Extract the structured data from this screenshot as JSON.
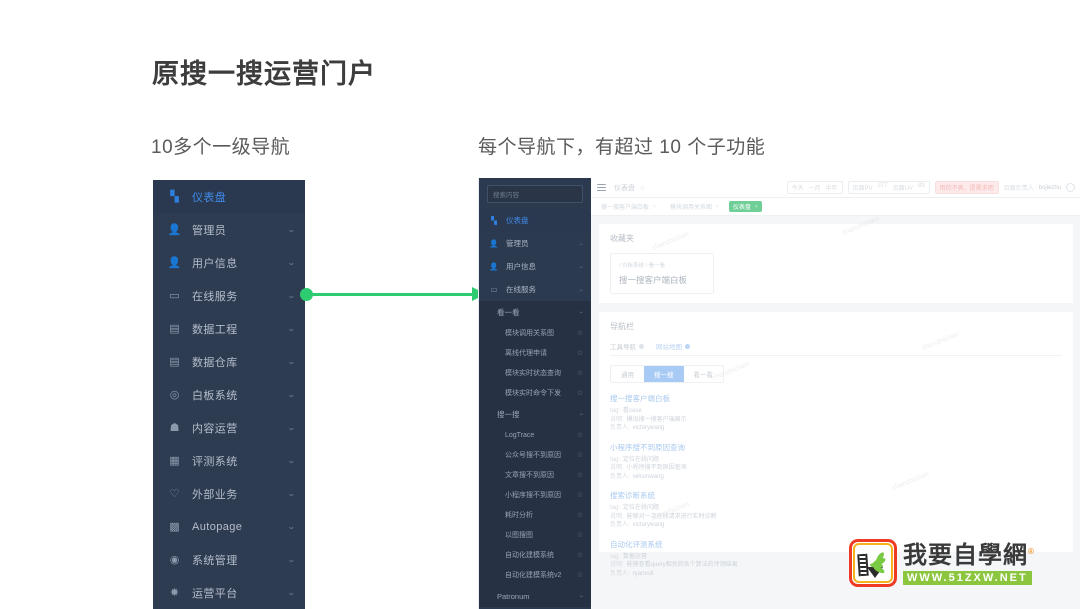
{
  "slide": {
    "title": "原搜一搜运营门户",
    "caption_left": "10多个一级导航",
    "caption_right": "每个导航下，有超过 10 个子功能"
  },
  "left_nav": {
    "items": [
      {
        "label": "仪表盘",
        "icon": "dashboard-icon",
        "glyph": "▚",
        "active": true,
        "chevron": ""
      },
      {
        "label": "管理员",
        "icon": "user-icon",
        "glyph": "👤",
        "active": false,
        "chevron": "⌄"
      },
      {
        "label": "用户信息",
        "icon": "user-info-icon",
        "glyph": "👤",
        "active": false,
        "chevron": "⌄"
      },
      {
        "label": "在线服务",
        "icon": "service-icon",
        "glyph": "▭",
        "active": false,
        "chevron": "⌄"
      },
      {
        "label": "数据工程",
        "icon": "data-engineering-icon",
        "glyph": "▤",
        "active": false,
        "chevron": "⌄"
      },
      {
        "label": "数据仓库",
        "icon": "data-warehouse-icon",
        "glyph": "▤",
        "active": false,
        "chevron": "⌄"
      },
      {
        "label": "白板系统",
        "icon": "whiteboard-icon",
        "glyph": "◎",
        "active": false,
        "chevron": "⌄"
      },
      {
        "label": "内容运营",
        "icon": "content-icon",
        "glyph": "☗",
        "active": false,
        "chevron": "⌄"
      },
      {
        "label": "评测系统",
        "icon": "evaluation-icon",
        "glyph": "▦",
        "active": false,
        "chevron": "⌄"
      },
      {
        "label": "外部业务",
        "icon": "external-business-icon",
        "glyph": "♡",
        "active": false,
        "chevron": "⌄"
      },
      {
        "label": "Autopage",
        "icon": "autopage-icon",
        "glyph": "▩",
        "active": false,
        "chevron": "⌄"
      },
      {
        "label": "系统管理",
        "icon": "system-management-icon",
        "glyph": "◉",
        "active": false,
        "chevron": "⌄"
      },
      {
        "label": "运营平台",
        "icon": "operation-platform-icon",
        "glyph": "✸",
        "active": false,
        "chevron": "⌄"
      }
    ]
  },
  "arrow": {
    "color": "#2ecc71",
    "name": "flow-arrow"
  },
  "app": {
    "sidebar": {
      "search_placeholder": "搜索内容",
      "items": [
        {
          "label": "仪表盘",
          "icon": "dashboard-icon",
          "glyph": "▚",
          "active": true,
          "chevron": ""
        },
        {
          "label": "管理员",
          "icon": "user-icon",
          "glyph": "👤",
          "active": false,
          "chevron": "⌄"
        },
        {
          "label": "用户信息",
          "icon": "user-info-icon",
          "glyph": "👤",
          "active": false,
          "chevron": "⌄"
        },
        {
          "label": "在线服务",
          "icon": "service-icon",
          "glyph": "▭",
          "active": false,
          "chevron": "⌄"
        }
      ],
      "groups": [
        {
          "label": "看一看",
          "chevron": "⌄",
          "children": [
            {
              "label": "模块调用关系图",
              "star": "☆"
            },
            {
              "label": "离线代理申请",
              "star": "☆"
            },
            {
              "label": "模块实时状态查询",
              "star": "☆"
            },
            {
              "label": "模块实时命令下发",
              "star": "☆"
            }
          ]
        },
        {
          "label": "搜一搜",
          "chevron": "⌄",
          "children": [
            {
              "label": "LogTrace",
              "star": "☆"
            },
            {
              "label": "公众号搜不到原因",
              "star": "☆"
            },
            {
              "label": "文章搜不到原因",
              "star": "☆"
            },
            {
              "label": "小程序搜不到原因",
              "star": "☆"
            },
            {
              "label": "耗时分析",
              "star": "☆"
            },
            {
              "label": "以图搜图",
              "star": "☆"
            },
            {
              "label": "自动化建模系统",
              "star": "☆"
            },
            {
              "label": "自动化建模系统v2",
              "star": "☆"
            }
          ]
        },
        {
          "label": "Patronum",
          "chevron": "⌄",
          "children": []
        }
      ]
    },
    "topbar": {
      "menu_icon": "hamburger-icon",
      "breadcrumb": "仪表盘",
      "star_icon": "☆",
      "ranges": [
        "今天",
        "一月",
        "半年"
      ],
      "pv_label": "页面PV",
      "pv_value": "377",
      "uv_label": "页面UV",
      "uv_value": "89",
      "alert_button": "用的不爽，提需求吧",
      "owner_label": "页面负责人",
      "owner_value": "bojiezhu"
    },
    "tabs": [
      {
        "label": "搜一搜客户端白板",
        "selected": false,
        "close": "×"
      },
      {
        "label": "模块调用关系图",
        "selected": false,
        "close": "×"
      },
      {
        "label": "仪表盘",
        "selected": true,
        "close": "×"
      }
    ],
    "favorites": {
      "title": "收藏夹",
      "card": {
        "breadcrumb": "/ 白板系统 / 看一看",
        "name": "搜一搜客户端白板"
      }
    },
    "navbar_card": {
      "title": "导航栏",
      "subtabs": [
        {
          "label": "工具导航",
          "on": false
        },
        {
          "label": "网站地图",
          "on": true
        }
      ],
      "segments": [
        {
          "label": "通用",
          "on": false
        },
        {
          "label": "搜一搜",
          "on": true
        },
        {
          "label": "看一看",
          "on": false
        }
      ],
      "entries": [
        {
          "title": "搜一搜客户端白板",
          "tag_label": "tag:",
          "tag_value": "看case",
          "desc_label": "说明:",
          "desc_value": "模拟搜一搜客户端展示",
          "owner_label": "负责人:",
          "owner_value": "victorywang"
        },
        {
          "title": "小程序搜不到原因查询",
          "tag_label": "tag:",
          "tag_value": "定位在线问题",
          "desc_label": "说明:",
          "desc_value": "小程序搜不到原因查询",
          "owner_label": "负责人:",
          "owner_value": "wilsonwang"
        },
        {
          "title": "搜索诊断系统",
          "tag_label": "tag:",
          "tag_value": "定位在线问题",
          "desc_label": "说明:",
          "desc_value": "能够对一次在线请求进行实时诊断",
          "owner_label": "负责人:",
          "owner_value": "victorywang"
        },
        {
          "title": "自动化评测系统",
          "tag_label": "tag:",
          "tag_value": "数据运营",
          "desc_label": "说明:",
          "desc_value": "能够查看query相关的各个算法的评测结果",
          "owner_label": "负责人:",
          "owner_value": "ryanxuli"
        }
      ]
    },
    "watermarks": [
      "zhenzhichen",
      "zhenzhichen",
      "zhenzhichen",
      "zhenzhichen",
      "zhenzhichen",
      "zhenzhichen"
    ]
  },
  "logo": {
    "name_cn": "我要自學網",
    "registered": "®",
    "url": "WWW.51ZXW.NET"
  },
  "colors": {
    "sidebar_bg": "#2e3c52",
    "sidebar_active": "#3f8bea",
    "arrow": "#2ecc71",
    "logo_green": "#8cc63e",
    "logo_red": "#ef3a24"
  }
}
